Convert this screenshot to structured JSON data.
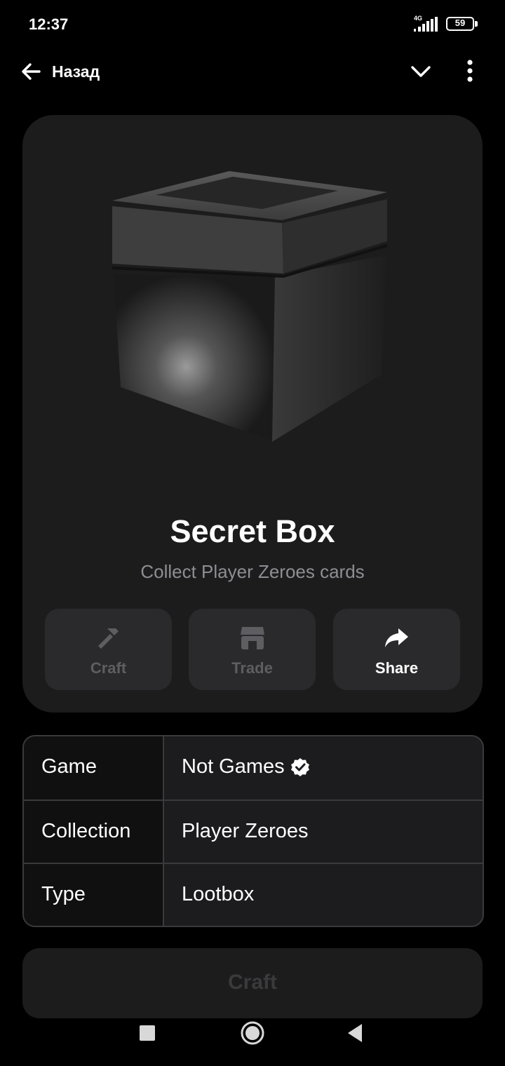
{
  "status_bar": {
    "time": "12:37",
    "network": "4G",
    "battery": "59"
  },
  "topbar": {
    "back_label": "Назад",
    "collapse_icon": "chevron-down-icon",
    "menu_icon": "more-vertical-icon"
  },
  "item": {
    "title": "Secret Box",
    "subtitle": "Collect Player Zeroes cards",
    "image": "secret-box-image"
  },
  "actions": [
    {
      "label": "Craft",
      "icon": "hammer-icon",
      "enabled": false
    },
    {
      "label": "Trade",
      "icon": "store-icon",
      "enabled": false
    },
    {
      "label": "Share",
      "icon": "share-arrow-icon",
      "enabled": true
    }
  ],
  "details": [
    {
      "key": "Game",
      "value": "Not Games",
      "verified": true
    },
    {
      "key": "Collection",
      "value": "Player Zeroes"
    },
    {
      "key": "Type",
      "value": "Lootbox"
    }
  ],
  "main_button": {
    "label": "Craft",
    "enabled": false
  },
  "colors": {
    "background": "#000000",
    "card": "#1c1c1d",
    "button": "#2a2a2c",
    "subtitle": "#8e8e93",
    "disabled_text": "#5e5e62"
  }
}
